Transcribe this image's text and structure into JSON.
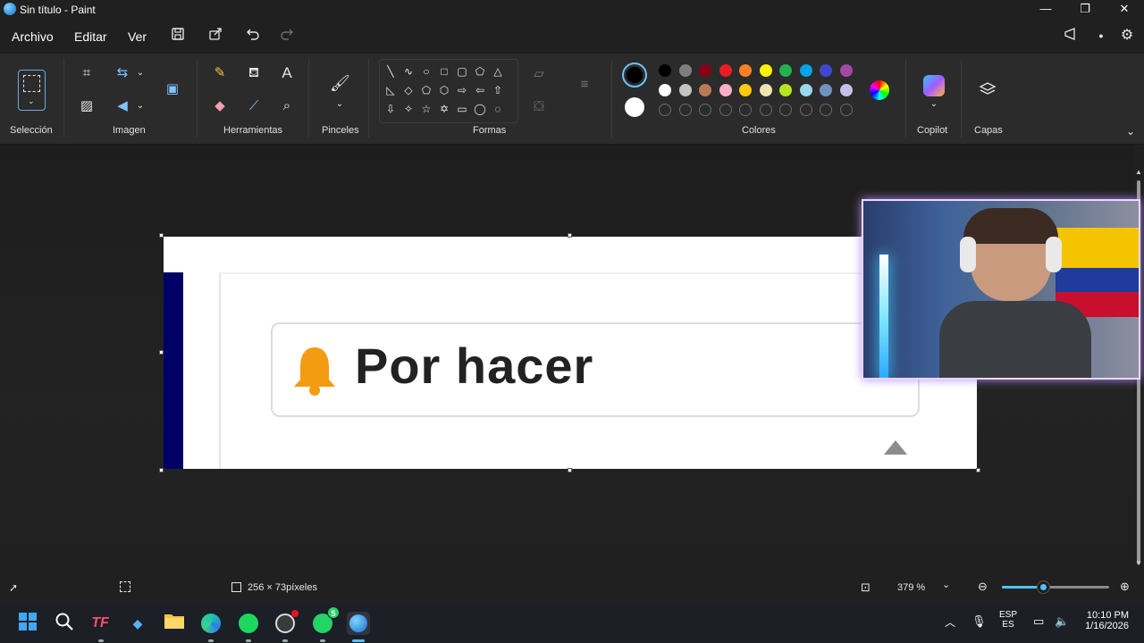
{
  "window": {
    "title": "Sin título - Paint",
    "minimize_glyph": "—",
    "restore_glyph": "❐",
    "close_glyph": "✕"
  },
  "menu": {
    "file": "Archivo",
    "edit": "Editar",
    "view": "Ver"
  },
  "ribbon": {
    "groups": {
      "selection": "Selección",
      "image": "Imagen",
      "tools": "Herramientas",
      "brushes": "Pinceles",
      "shapes": "Formas",
      "colors": "Colores",
      "copilot": "Copilot",
      "layers": "Capas"
    },
    "text_tool_glyph": "A",
    "primary_color": "#000000",
    "secondary_color": "#ffffff",
    "palette_row1": [
      "#000000",
      "#7f7f7f",
      "#880015",
      "#ed1c24",
      "#ff7f27",
      "#fff200",
      "#22b14c",
      "#00a2e8",
      "#3f48cc",
      "#a349a4"
    ],
    "palette_row2": [
      "#ffffff",
      "#c3c3c3",
      "#b97a57",
      "#ffaec9",
      "#ffc90e",
      "#efe4b0",
      "#b5e61d",
      "#99d9ea",
      "#7092be",
      "#c8bfe7"
    ]
  },
  "canvas": {
    "label_text": "Por hacer",
    "bell_color": "#f39c12",
    "sidebar_color": "#000066"
  },
  "status": {
    "dimensions": "256 × 73píxeles",
    "zoom": "379 %",
    "zoom_level": 0.38
  },
  "taskbar": {
    "lang_top": "ESP",
    "lang_bottom": "ES",
    "time": "10:10 PM",
    "date": "1/16/2026",
    "whatsapp_badge": "5",
    "tf_label": "TF"
  }
}
